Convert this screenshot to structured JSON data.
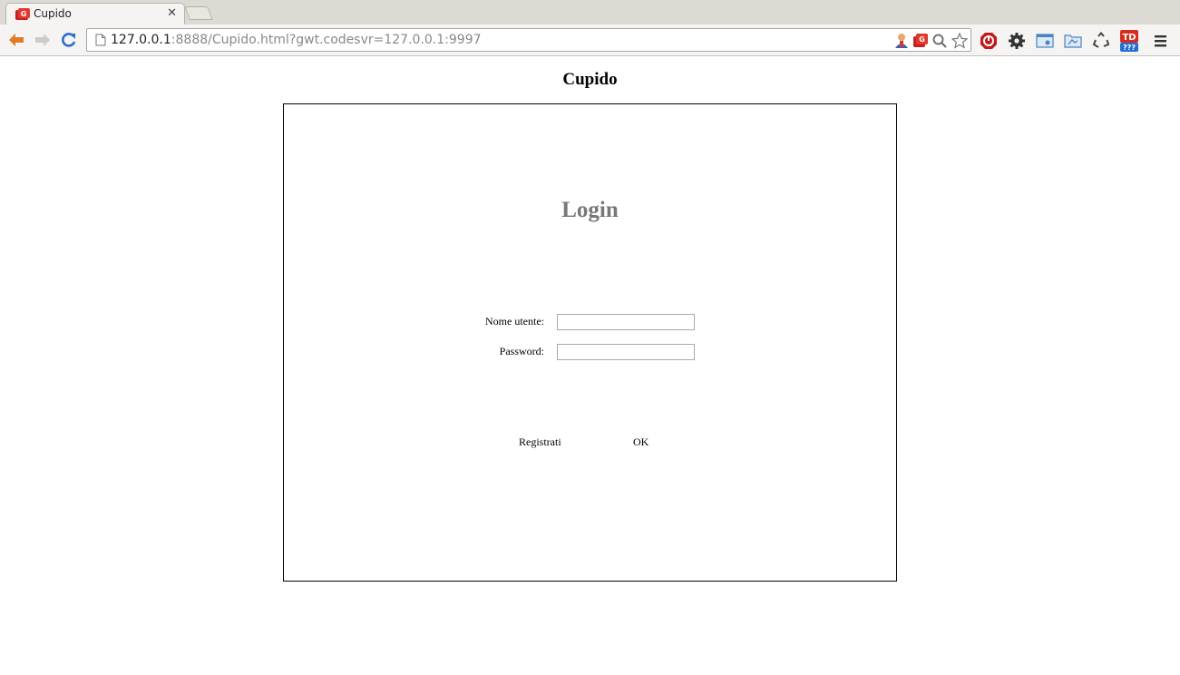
{
  "browser": {
    "tab": {
      "title": "Cupido"
    },
    "address": {
      "host": "127.0.0.1",
      "rest": ":8888/Cupido.html?gwt.codesvr=127.0.0.1:9997"
    }
  },
  "page": {
    "title": "Cupido",
    "login": {
      "heading": "Login",
      "username_label": "Nome utente:",
      "username_value": "",
      "password_label": "Password:",
      "password_value": "",
      "register_label": "Registrati",
      "ok_label": "OK"
    }
  },
  "colors": {
    "heading_gray": "#777777",
    "back_arrow": "#e07b2a",
    "reload": "#2a6fc9"
  }
}
